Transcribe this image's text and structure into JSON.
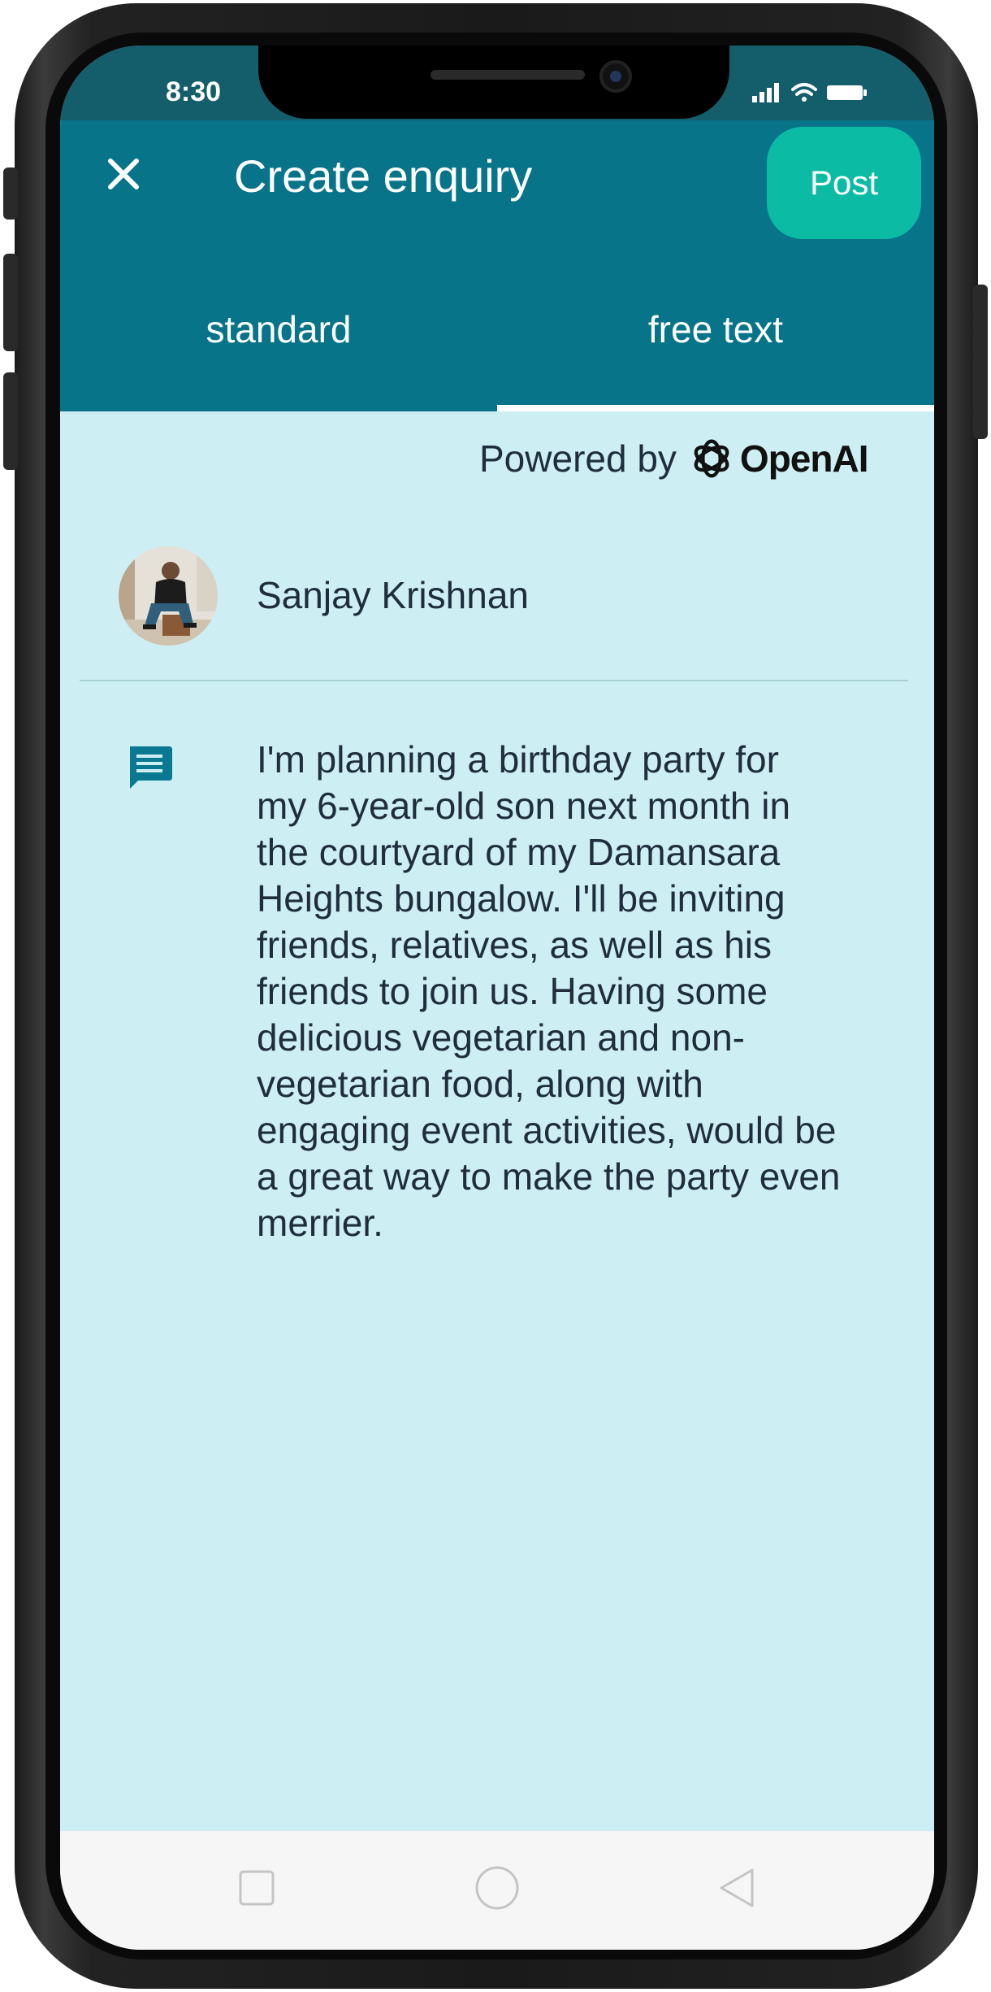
{
  "status_bar": {
    "time": "8:30"
  },
  "app_bar": {
    "title": "Create enquiry",
    "post_label": "Post",
    "tabs": [
      {
        "label": "standard",
        "selected": false
      },
      {
        "label": "free text",
        "selected": true
      }
    ]
  },
  "powered_by": {
    "prefix": "Powered by",
    "brand": "OpenAI"
  },
  "user": {
    "name": "Sanjay Krishnan"
  },
  "message": {
    "text": "I'm planning a birthday party for\nmy 6-year-old son next month in\nthe courtyard of my Damansara\nHeights bungalow. I'll be inviting\nfriends, relatives, as well as his\nfriends to join us. Having some\ndelicious vegetarian and non-\nvegetarian food, along with\nengaging event activities, would be\na great way to make the party even\nmerrier."
  },
  "colors": {
    "app_bar": "#077489",
    "status_bar": "#145e6b",
    "post_button": "#0bbba4",
    "content_background": "#cdeff4",
    "text": "#1f2d3d",
    "message_icon": "#0a7890"
  },
  "icons": {
    "close": "close-icon",
    "message": "message-icon",
    "openai": "openai-logo-icon",
    "nav": [
      "square-icon",
      "circle-icon",
      "back-triangle-icon"
    ]
  }
}
